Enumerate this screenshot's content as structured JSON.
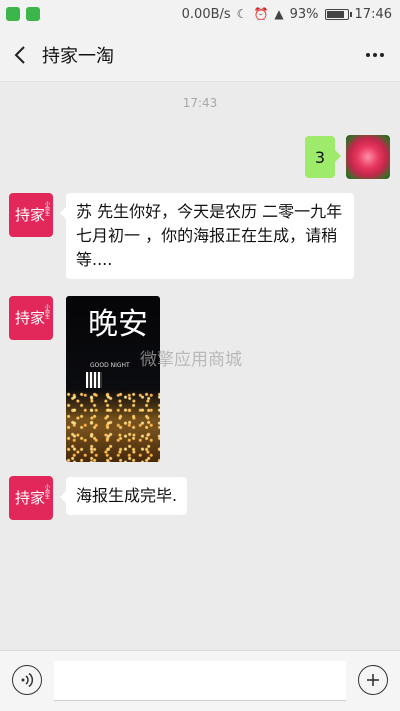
{
  "status_bar": {
    "speed": "0.00B/s",
    "battery_text": "93%",
    "battery_level": 0.93,
    "time": "17:46"
  },
  "header": {
    "title": "持家一淘",
    "back_icon": "chevron-left-icon",
    "more_icon": "more-dots-icon"
  },
  "chat": {
    "timestamp": "17:43",
    "sent_message": "3",
    "brand_avatar_text": "持家",
    "brand_avatar_small": "小俞生",
    "greeting_message": "苏  先生你好，今天是农历  二零一九年七月初一 ，你的海报正在生成，请稍等....",
    "poster": {
      "title": "晚安",
      "subtitle": "GOOD NIGHT"
    },
    "done_message": "海报生成完毕."
  },
  "watermark": "微擎应用商城",
  "input": {
    "value": "",
    "voice_icon": "voice-icon",
    "plus_icon": "plus-icon"
  }
}
